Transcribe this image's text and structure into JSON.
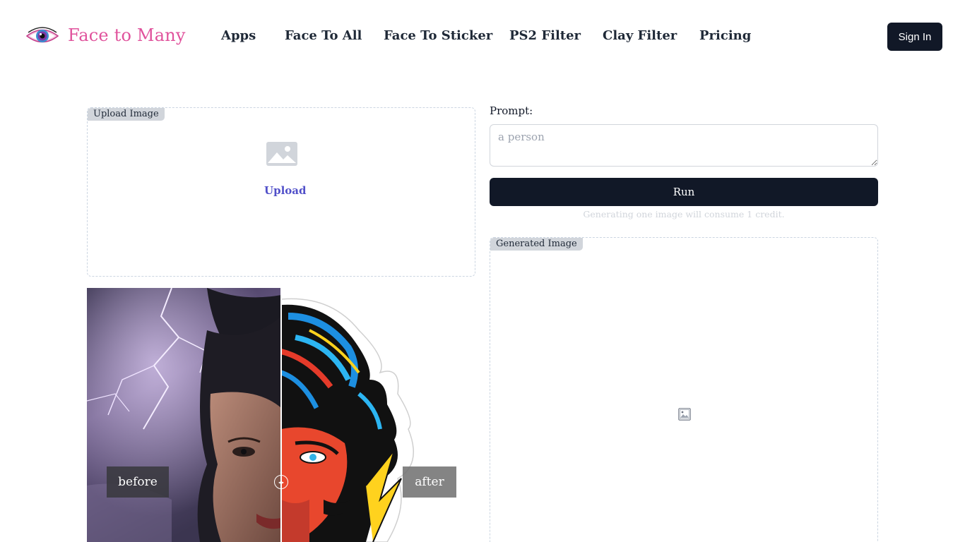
{
  "header": {
    "brand": "Face to Many",
    "nav": [
      {
        "label": "Apps"
      },
      {
        "label": "Face To All"
      },
      {
        "label": "Face To Sticker"
      },
      {
        "label": "PS2 Filter"
      },
      {
        "label": "Clay Filter"
      },
      {
        "label": "Pricing"
      }
    ],
    "sign_in": "Sign In"
  },
  "upload": {
    "label": "Upload Image",
    "link": "Upload"
  },
  "compare": {
    "before_label": "before",
    "after_label": "after"
  },
  "prompt": {
    "label": "Prompt:",
    "placeholder": "a person",
    "value": ""
  },
  "run": {
    "label": "Run",
    "note": "Generating one image will consume 1 credit."
  },
  "generated": {
    "label": "Generated Image"
  },
  "colors": {
    "brand": "#e0529c",
    "primary": "#111827",
    "link": "#5150c9"
  },
  "icons": [
    "eye-logo-icon",
    "image-upload-icon",
    "compare-handle-icon",
    "broken-image-icon"
  ]
}
